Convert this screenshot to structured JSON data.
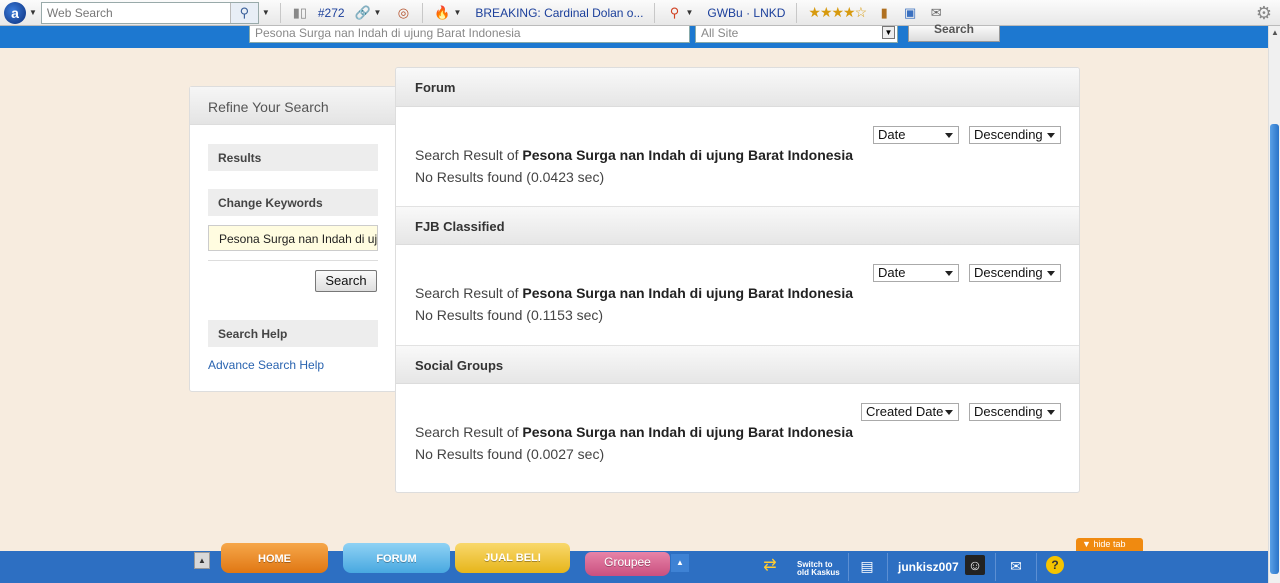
{
  "toolbar": {
    "web_search_placeholder": "Web Search",
    "count": "#272",
    "breaking": "BREAKING: Cardinal Dolan o...",
    "links": "GWBu · LNKD"
  },
  "header": {
    "search_value": "Pesona Surga nan Indah di ujung Barat Indonesia",
    "site_select": "All Site",
    "search_button": "Search"
  },
  "refine": {
    "title": "Refine Your Search",
    "results_label": "Results",
    "change_keywords_label": "Change Keywords",
    "keyword_value": "Pesona Surga nan Indah di ujung Barat Indonesia",
    "search_button": "Search",
    "help_label": "Search Help",
    "help_link": "Advance Search Help"
  },
  "sections": [
    {
      "title": "Forum",
      "sort_by": "Date",
      "order": "Descending",
      "result_prefix": "Search Result of",
      "query": "Pesona Surga nan Indah di ujung Barat Indonesia",
      "status": "No Results found (0.0423 sec)"
    },
    {
      "title": "FJB Classified",
      "sort_by": "Date",
      "order": "Descending",
      "result_prefix": "Search Result of",
      "query": "Pesona Surga nan Indah di ujung Barat Indonesia",
      "status": "No Results found (0.1153 sec)"
    },
    {
      "title": "Social Groups",
      "sort_by": "Created Date",
      "order": "Descending",
      "result_prefix": "Search Result of",
      "query": "Pesona Surga nan Indah di ujung Barat Indonesia",
      "status": "No Results found (0.0027 sec)"
    }
  ],
  "bottom": {
    "home": "HOME",
    "forum": "FORUM",
    "jual_beli": "JUAL BELI",
    "groupee": "Groupee",
    "switch_line1": "Switch to",
    "switch_line2": "old Kaskus",
    "username": "junkisz007",
    "hide_tab": "hide tab"
  }
}
